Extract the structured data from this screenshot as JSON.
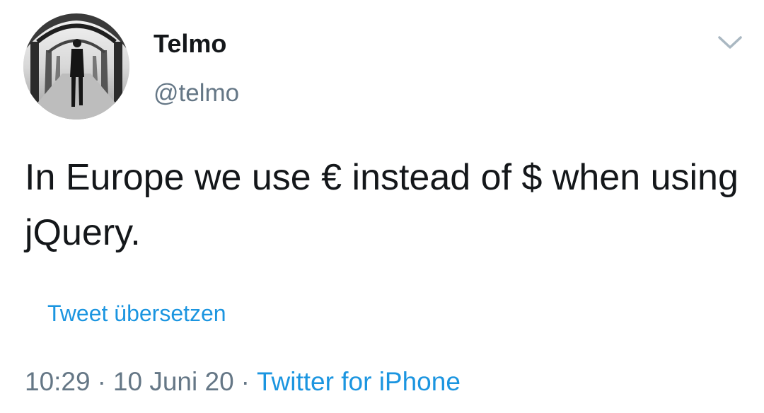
{
  "author": {
    "name": "Telmo",
    "handle": "@telmo"
  },
  "tweet": {
    "text": "In Europe we use € instead of $ when using jQuery."
  },
  "translate": {
    "label": "Tweet übersetzen"
  },
  "meta": {
    "time": "10:29",
    "separator": "·",
    "date": "10 Juni 20",
    "source": "Twitter for iPhone"
  },
  "icons": {
    "menu": "chevron-down-icon"
  },
  "colors": {
    "text": "#14171a",
    "secondary": "#657786",
    "link": "#1b95e0"
  }
}
